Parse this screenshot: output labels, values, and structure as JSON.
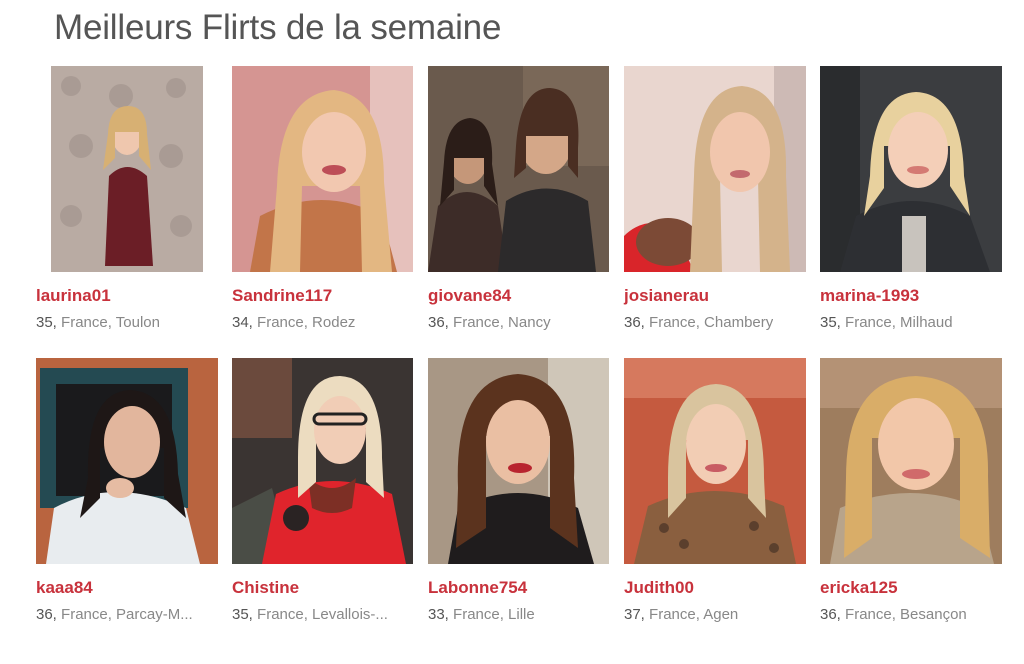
{
  "page": {
    "title": "Meilleurs Flirts de la semaine"
  },
  "profiles": [
    {
      "username": "laurina01",
      "age": "35,",
      "location": "France, Toulon",
      "photo": "profile-photo"
    },
    {
      "username": "Sandrine117",
      "age": "34,",
      "location": "France, Rodez",
      "photo": "profile-photo"
    },
    {
      "username": "giovane84",
      "age": "36,",
      "location": "France, Nancy",
      "photo": "profile-photo"
    },
    {
      "username": "josianerau",
      "age": "36,",
      "location": "France, Chambery",
      "photo": "profile-photo"
    },
    {
      "username": "marina-1993",
      "age": "35,",
      "location": "France, Milhaud",
      "photo": "profile-photo"
    },
    {
      "username": "kaaa84",
      "age": "36,",
      "location": "France, Parcay-M...",
      "photo": "profile-photo"
    },
    {
      "username": "Chistine",
      "age": "35,",
      "location": "France, Levallois-...",
      "photo": "profile-photo"
    },
    {
      "username": "Labonne754",
      "age": "33,",
      "location": "France, Lille",
      "photo": "profile-photo"
    },
    {
      "username": "Judith00",
      "age": "37,",
      "location": "France, Agen",
      "photo": "profile-photo"
    },
    {
      "username": "ericka125",
      "age": "36,",
      "location": "France, Besançon",
      "photo": "profile-photo"
    }
  ],
  "colors": {
    "title": "#555555",
    "username": "#c8323c",
    "age": "#555555",
    "location": "#888888"
  }
}
